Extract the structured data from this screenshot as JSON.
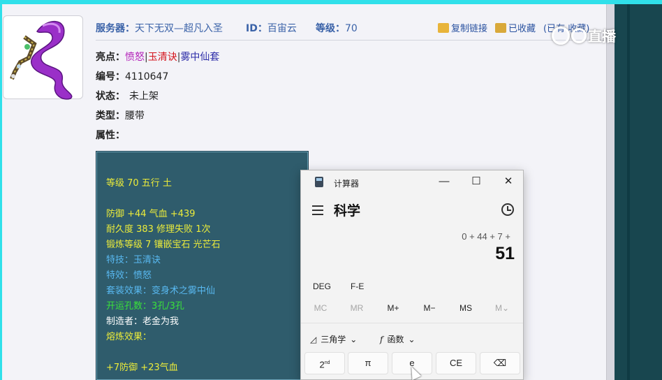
{
  "item": {
    "server_label": "服务器：",
    "server_value": "天下无双—超凡入圣",
    "id_label": "ID：",
    "id_value": "百宙云",
    "level_label": "等级：",
    "level_value": "70",
    "copy_link": "复制链接",
    "favorited": "已收藏",
    "fav_count": "(已有 收藏)",
    "highlights_label": "亮点：",
    "highlights": [
      "愤怒",
      "玉清诀",
      "雾中仙套"
    ],
    "separator": "|",
    "number_label": "编号：",
    "number_value": "4110647",
    "status_label": "状态：",
    "status_value": "未上架",
    "type_label": "类型：",
    "type_value": "腰带",
    "attr_label": "属性："
  },
  "watermark": "直播",
  "tooltip": {
    "lines": [
      "等级 70 五行 土",
      "防御 +44 气血 +439",
      "耐久度 383 修理失败 1次",
      "锻炼等级 7 镶嵌宝石 光芒石",
      "特技：玉清诀",
      "特效：愤怒",
      "套装效果：变身术之雾中仙",
      "开运孔数：3孔/3孔",
      "制造者：老金为我",
      "熔炼效果：",
      "+7防御 +23气血"
    ]
  },
  "calculator": {
    "title": "计算器",
    "mode": "科学",
    "expression": "0 + 44 + 7 +",
    "result": "51",
    "angle_mode": "DEG",
    "fe": "F-E",
    "memory": [
      "MC",
      "MR",
      "M+",
      "M−",
      "MS",
      "M⌄"
    ],
    "trig_label": "三角学",
    "func_label": "函数",
    "keys": [
      "2",
      "π",
      "e",
      "CE",
      "⌫"
    ],
    "key_sup": "nd",
    "win_min": "—",
    "win_max": "☐",
    "win_close": "✕"
  },
  "colors": {
    "tooltip_bg": "#2f5c6c",
    "yellow": "#ecec3a",
    "blue": "#58b8f0",
    "green": "#3ae23a",
    "link": "#3a62a8"
  }
}
